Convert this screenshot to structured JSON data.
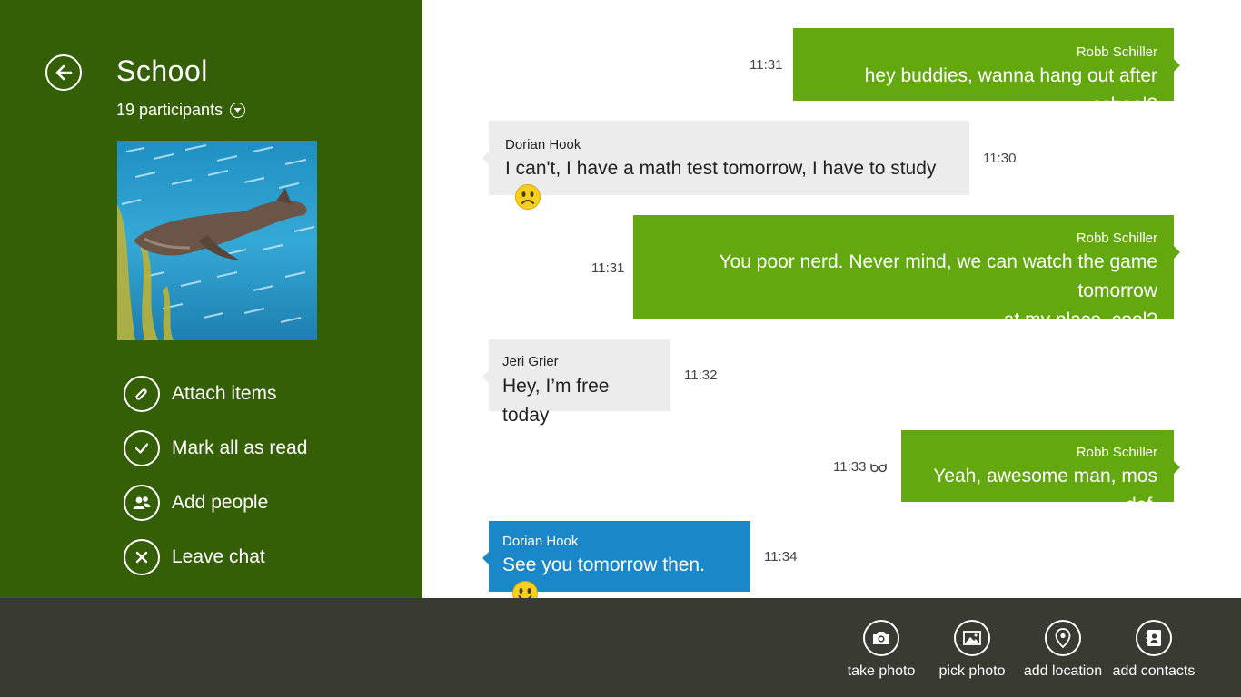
{
  "sidebar": {
    "title": "School",
    "participants": "19 participants",
    "actions": [
      {
        "label": "Attach items",
        "icon": "paperclip-icon"
      },
      {
        "label": "Mark all as read",
        "icon": "checkmark-icon"
      },
      {
        "label": "Add people",
        "icon": "people-icon"
      },
      {
        "label": "Leave chat",
        "icon": "close-icon"
      }
    ]
  },
  "messages": [
    {
      "sender": "Robb Schiller",
      "text": "hey buddies, wanna hang out after school?",
      "time": "11:31",
      "direction": "outgoing"
    },
    {
      "sender": "Dorian Hook",
      "text": "I can't, I have a math test tomorrow, I have to study",
      "time": "11:30",
      "direction": "incoming",
      "emoji": "sad-emoji"
    },
    {
      "sender": "Robb Schiller",
      "text_line1": "You poor nerd. Never mind, we can watch the game tomorrow",
      "text_line2": "at my place, cool?",
      "time": "11:31",
      "direction": "outgoing"
    },
    {
      "sender": "Jeri Grier",
      "text": "Hey, I’m free today",
      "time": "11:32",
      "direction": "incoming"
    },
    {
      "sender": "Robb Schiller",
      "text": "Yeah, awesome man, mos def.",
      "time": "11:33",
      "direction": "outgoing",
      "status_icon": "glasses-icon"
    },
    {
      "sender": "Dorian Hook",
      "text": "See you tomorrow then.",
      "time": "11:34",
      "direction": "incoming",
      "emoji": "smile-emoji"
    }
  ],
  "appbar": {
    "buttons": [
      {
        "label": "take photo",
        "icon": "camera-icon"
      },
      {
        "label": "pick photo",
        "icon": "picture-icon"
      },
      {
        "label": "add location",
        "icon": "location-pin-icon"
      },
      {
        "label": "add contacts",
        "icon": "contacts-icon"
      }
    ]
  },
  "colors": {
    "sidebar_bg": "#355f06",
    "outgoing_bubble": "#63a80e",
    "incoming_bubble": "#ececec",
    "selected_bubble": "#1a87c9",
    "appbar_bg": "#393a32"
  }
}
